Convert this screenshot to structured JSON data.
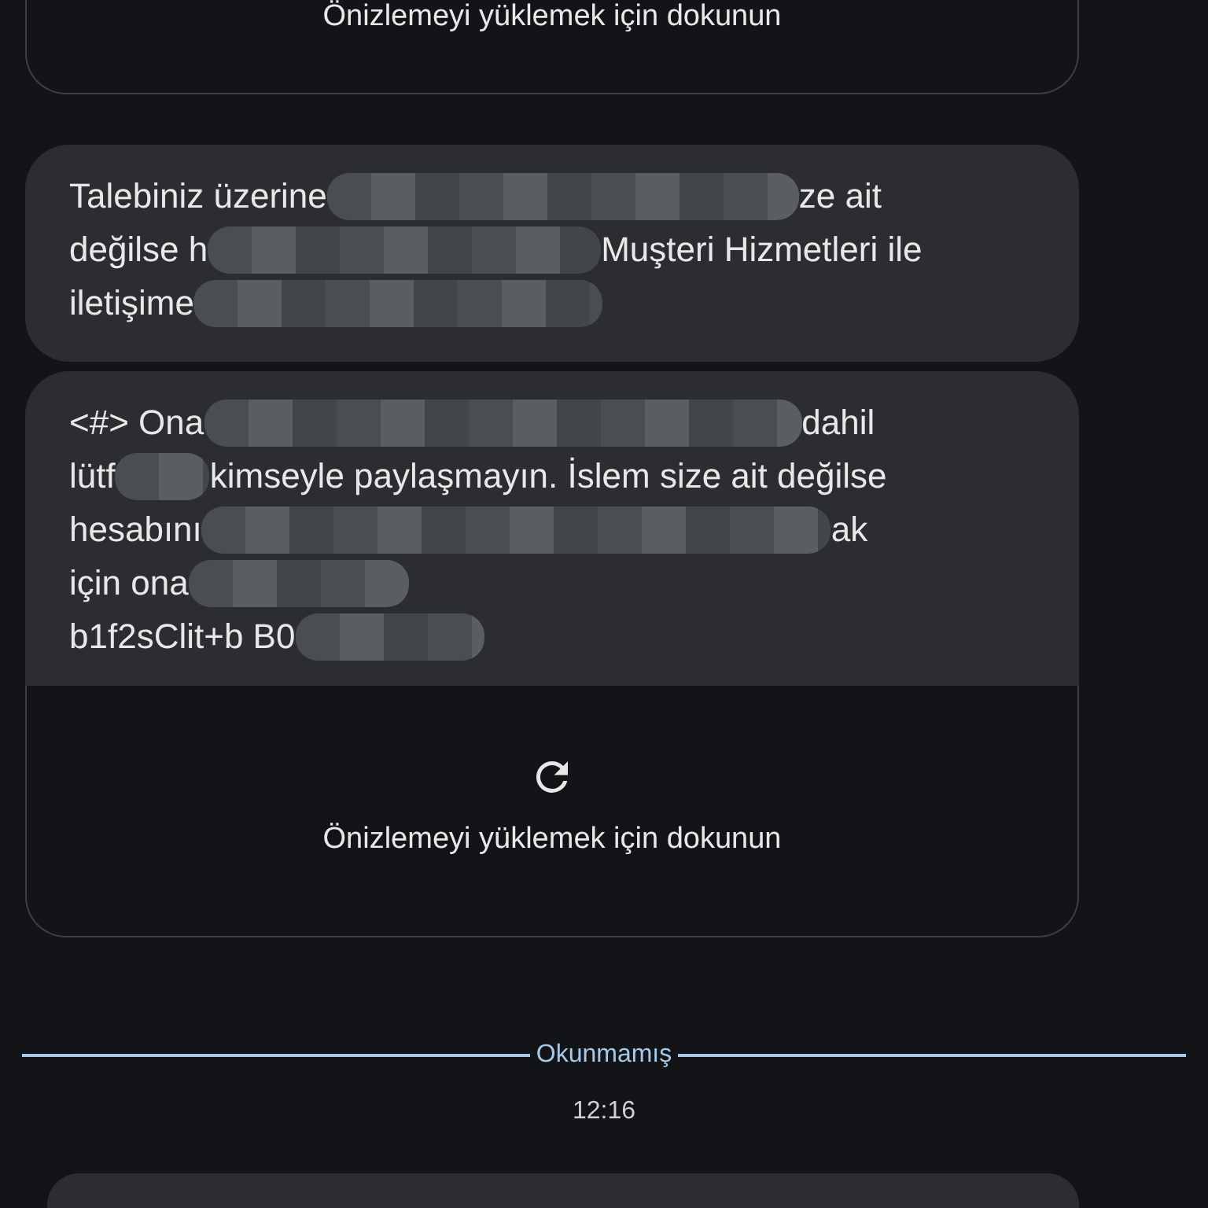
{
  "previous_preview": {
    "text": "Önizlemeyi yüklemek için dokunun"
  },
  "messages": [
    {
      "lines": [
        [
          {
            "text": "Talebiniz üzerine"
          },
          {
            "kind": "redacted"
          },
          {
            "text": "ze ait"
          }
        ],
        [
          {
            "text": "değilse h"
          },
          {
            "kind": "redacted"
          },
          {
            "text": "Muşteri Hizmetleri ile"
          }
        ],
        [
          {
            "text": "iletişime"
          },
          {
            "kind": "redacted"
          }
        ]
      ]
    },
    {
      "lines": [
        [
          {
            "text": "<#> Ona"
          },
          {
            "kind": "redacted"
          },
          {
            "text": "dahil"
          }
        ],
        [
          {
            "text": "lütf"
          },
          {
            "kind": "redacted"
          },
          {
            "text": "kimseyle paylaşmayın. İslem size ait değilse"
          }
        ],
        [
          {
            "text": "hesabını"
          },
          {
            "kind": "redacted"
          },
          {
            "text": "ak"
          }
        ],
        [
          {
            "text": "için ona"
          },
          {
            "kind": "redacted"
          }
        ],
        [
          {
            "text": "b1f2sClit+b B0"
          },
          {
            "kind": "redacted"
          }
        ]
      ],
      "preview": {
        "text": "Önizlemeyi yüklemek için dokunun"
      }
    }
  ],
  "divider": {
    "label": "Okunmamış"
  },
  "timestamp": "12:16"
}
